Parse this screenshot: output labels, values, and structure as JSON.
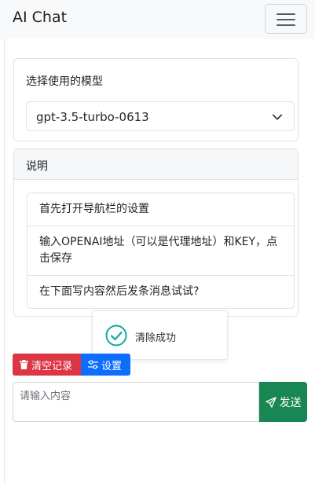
{
  "navbar": {
    "brand": "AI Chat",
    "toggler_icon": "hamburger-icon"
  },
  "model": {
    "label": "选择使用的模型",
    "selected": "gpt-3.5-turbo-0613"
  },
  "info": {
    "header": "说明",
    "items": [
      "首先打开导航栏的设置",
      "输入OPENAI地址（可以是代理地址）和KEY，点击保存",
      "在下面写内容然后发条消息试试?"
    ]
  },
  "toast": {
    "message": "清除成功",
    "icon": "check-circle-icon"
  },
  "actions": {
    "clear_label": "清空记录",
    "clear_icon": "trash-icon",
    "settings_label": "设置",
    "settings_icon": "sliders-icon"
  },
  "composer": {
    "placeholder": "请输入内容",
    "value": "",
    "send_label": "发送",
    "send_icon": "paper-plane-icon"
  },
  "colors": {
    "danger": "#dc3545",
    "primary": "#0d6efd",
    "success": "#198754",
    "toast_check": "#13a89e"
  }
}
